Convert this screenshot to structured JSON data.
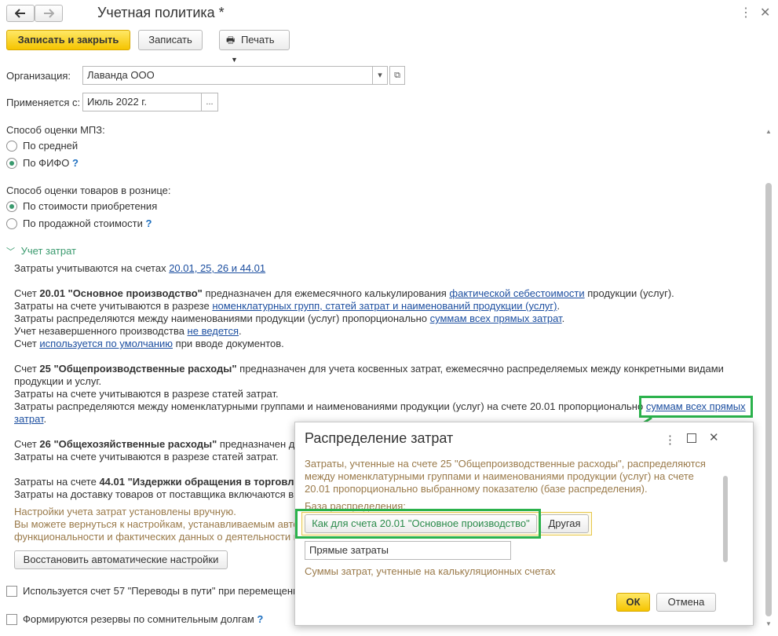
{
  "window": {
    "title": "Учетная политика *"
  },
  "toolbar": {
    "save_close": "Записать и закрыть",
    "save": "Записать",
    "print": "Печать"
  },
  "form": {
    "org_label": "Организация:",
    "org_value": "Лаванда ООО",
    "applies_label": "Применяется с:",
    "applies_value": "Июль 2022 г.",
    "applies_btn": "..."
  },
  "mpz": {
    "label": "Способ оценки МПЗ:",
    "opt1": "По средней",
    "opt2": "По ФИФО",
    "selected": "По ФИФО"
  },
  "retail": {
    "label": "Способ оценки товаров в рознице:",
    "opt1": "По стоимости приобретения",
    "opt2": "По продажной стоимости",
    "selected": "По стоимости приобретения"
  },
  "costs": {
    "section_title": "Учет затрат",
    "accounts_text": "Затраты учитываются на счетах ",
    "accounts_link": "20.01, 25, 26 и 44.01",
    "p20_1a": "Счет ",
    "p20_1b": "20.01 \"Основное производство\"",
    "p20_1c": " предназначен для ежемесячного калькулирования ",
    "p20_1link": "фактической себестоимости",
    "p20_1d": " продукции (услуг).",
    "p20_2a": "Затраты на счете учитываются в разрезе ",
    "p20_2link": "номенклатурных групп, статей затрат и наименований продукции (услуг)",
    "p20_2b": ".",
    "p20_3a": "Затраты распределяются между наименованиями продукции (услуг) пропорционально ",
    "p20_3link": "суммам всех прямых затрат",
    "p20_3b": ".",
    "p20_4a": "Учет незавершенного производства ",
    "p20_4link": "не ведется",
    "p20_4b": ".",
    "p20_5a": "Счет ",
    "p20_5link": "используется по умолчанию",
    "p20_5b": " при вводе документов.",
    "p25_1a": "Счет ",
    "p25_1b": "25 \"Общепроизводственные расходы\"",
    "p25_1c": " предназначен для учета косвенных затрат, ежемесячно распределяемых между конкретными видами",
    "p25_2": "продукции и услуг.",
    "p25_3": "Затраты на счете учитываются в разрезе статей затрат.",
    "p25_4a": "Затраты распределяются между номенклатурными группами и наименованиями продукции (услуг) на счете 20.01 пропорционально ",
    "p25_4link": "суммам всех прямых",
    "p25_5link": "затрат",
    "p25_5b": ".",
    "p26_1a": "Счет ",
    "p26_1b": "26 \"Общехозяйственные расходы\"",
    "p26_1c": " предназначен д",
    "p26_2": "Затраты на счете учитываются в разрезе статей затрат.",
    "p44_1a": "Затраты на счете ",
    "p44_1b": "44.01 \"Издержки обращения в торговл",
    "p44_2": "Затраты на доставку товаров от поставщика включаются в",
    "note1": "Настройки учета затрат установлены вручную.",
    "note2": "Вы можете вернуться к настройкам, устанавливаемым авто",
    "note3": "функциональности и фактических данных о деятельности п",
    "restore_btn": "Восстановить автоматические настройки"
  },
  "checks": {
    "c57": "Используется счет 57 \"Переводы в пути\" при перемещени",
    "reserves": "Формируются резервы по сомнительным долгам"
  },
  "dialog": {
    "title": "Распределение затрат",
    "desc1": "Затраты, учтенные на счете 25 \"Общепроизводственные расходы\", распределяются",
    "desc2": "между номенклатурными группами и наименованиями продукции (услуг) на счете",
    "desc3": "20.01 пропорционально выбранному показателю (базе распределения).",
    "base_label": "База распределения:",
    "opt_same": "Как для счета 20.01 \"Основное производство\"",
    "opt_other": "Другая",
    "field_value": "Прямые затраты",
    "field_hint": "Суммы затрат, учтенные на калькуляционных счетах",
    "ok": "ОК",
    "cancel": "Отмена"
  },
  "colors": {
    "accent_yellow": "#f5c400",
    "link_blue": "#1d4fa0",
    "highlight_green": "#2bb24c",
    "hint_brown": "#9a7a4a"
  }
}
